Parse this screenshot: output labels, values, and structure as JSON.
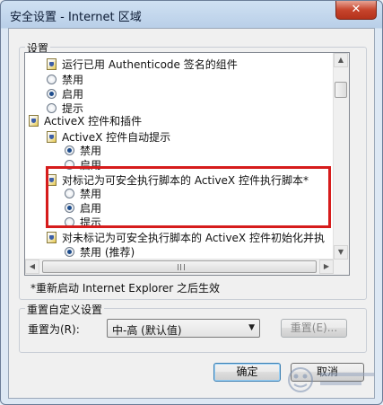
{
  "window": {
    "title": "安全设置 - Internet 区域",
    "close_glyph": "✕"
  },
  "settings": {
    "group_label": "设置",
    "tree_items": [
      {
        "kind": "node",
        "label": "运行已用 Authenticode 签名的组件",
        "icon": "activex-component-icon"
      },
      {
        "kind": "radio",
        "label": "禁用",
        "checked": false
      },
      {
        "kind": "radio",
        "label": "启用",
        "checked": true
      },
      {
        "kind": "radio",
        "label": "提示",
        "checked": false
      },
      {
        "kind": "node",
        "label": "ActiveX 控件和插件",
        "icon": "activex-security-icon"
      },
      {
        "kind": "node",
        "label": "ActiveX 控件自动提示",
        "icon": "activex-security-icon"
      },
      {
        "kind": "radio",
        "label": "禁用",
        "checked": true
      },
      {
        "kind": "radio",
        "label": "启用",
        "checked": false
      },
      {
        "kind": "node",
        "label": "对标记为可安全执行脚本的 ActiveX 控件执行脚本*",
        "icon": "activex-security-icon"
      },
      {
        "kind": "radio",
        "label": "禁用",
        "checked": false
      },
      {
        "kind": "radio",
        "label": "启用",
        "checked": true
      },
      {
        "kind": "radio",
        "label": "提示",
        "checked": false
      },
      {
        "kind": "node",
        "label": "对未标记为可安全执行脚本的 ActiveX 控件初始化并执",
        "icon": "activex-security-icon"
      },
      {
        "kind": "radio",
        "label": "禁用 (推荐)",
        "checked": true
      }
    ],
    "restart_note": "*重新启动 Internet Explorer 之后生效"
  },
  "reset": {
    "group_label": "重置自定义设置",
    "reset_to_label": "重置为(R):",
    "selected_level": "中-高 (默认值)",
    "reset_button": "重置(E)..."
  },
  "buttons": {
    "ok": "确定",
    "cancel": "取消"
  },
  "colors": {
    "highlight": "#d61c1c",
    "title_bar": "#b9cfe8"
  }
}
